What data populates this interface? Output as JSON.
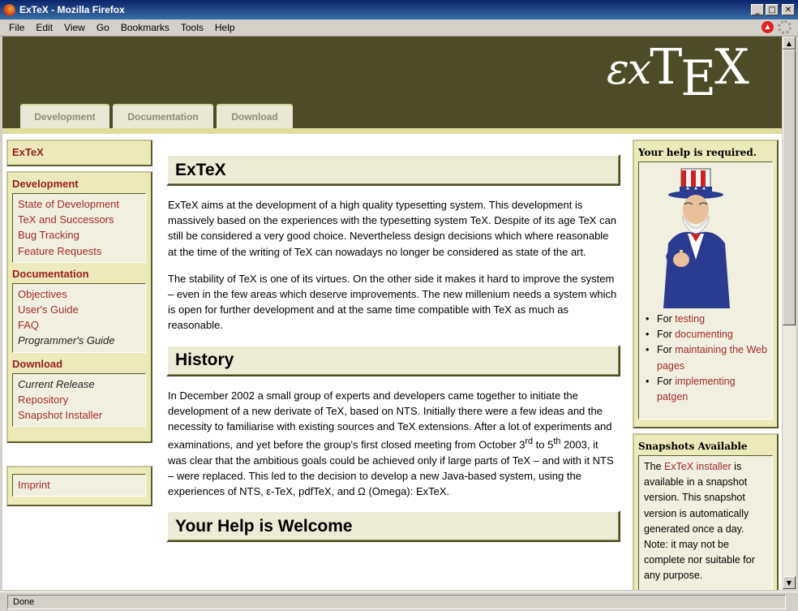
{
  "window": {
    "title": "ExTeX - Mozilla Firefox",
    "min": "_",
    "max": "□",
    "close": "✕"
  },
  "menu": [
    "File",
    "Edit",
    "View",
    "Go",
    "Bookmarks",
    "Tools",
    "Help"
  ],
  "status": "Done",
  "header": {
    "logo": {
      "e": "ε",
      "x": "x",
      "t": "T",
      "sub_e": "E",
      "x2": "X"
    },
    "tabs": [
      "Development",
      "Documentation",
      "Download"
    ]
  },
  "nav": {
    "home": "ExTeX",
    "development": {
      "title": "Development",
      "items": [
        "State of Development",
        "TeX and Successors",
        "Bug Tracking",
        "Feature Requests"
      ]
    },
    "documentation": {
      "title": "Documentation",
      "items": [
        "Objectives",
        "User's Guide",
        "FAQ"
      ],
      "current": "Programmer's Guide"
    },
    "download": {
      "title": "Download",
      "current": "Current Release",
      "items": [
        "Repository",
        "Snapshot Installer"
      ]
    },
    "imprint": "Imprint"
  },
  "main": {
    "h1": "ExTeX",
    "p1": "ExTeX aims at the development of a high quality typesetting system. This development is massively based on the experiences with the typesetting system TeX. Despite of its age TeX can still be considered a very good choice. Nevertheless design decisions which where reasonable at the time of the writing of TeX can nowadays no longer be considered as state of the art.",
    "p2": "The stability of TeX is one of its virtues. On the other side it makes it hard to improve the system – even in the few areas which deserve improvements. The new millenium needs a system which is open for further development and at the same time compatible with TeX as much as reasonable.",
    "h2": "History",
    "p3a": "In December 2002 a small group of experts and developers came together to initiate the development of a new derivate of TeX, based on NTS. Initially there were a few ideas and the necessity to familiarise with existing sources and TeX extensions. After a lot of experiments and examinations, and yet before the group's first closed meeting from October 3",
    "p3_sup1": "rd",
    "p3b": " to 5",
    "p3_sup2": "th",
    "p3c": " 2003, it was clear that the ambitious goals could be achieved only if large parts of TeX – and with it NTS – were replaced. This led to the decision to develop a new Java-based system, using the experiences of NTS, ε-TeX, pdfTeX, and Ω (Omega): ExTeX.",
    "h3": "Your Help is Welcome"
  },
  "help": {
    "title": "Your help is required.",
    "items": [
      {
        "prefix": "For ",
        "link": "testing"
      },
      {
        "prefix": "For ",
        "link": "documenting"
      },
      {
        "prefix": "For ",
        "link": "maintaining the Web pages"
      },
      {
        "prefix": "For ",
        "link": "implementing patgen"
      }
    ]
  },
  "snapshots": {
    "title": "Snapshots Available",
    "pre": "The ",
    "link": "ExTeX installer",
    "post": " is available in a snapshot version. This snapshot version is automatically generated once a day. Note: it may not be complete nor suitable for any purpose."
  }
}
